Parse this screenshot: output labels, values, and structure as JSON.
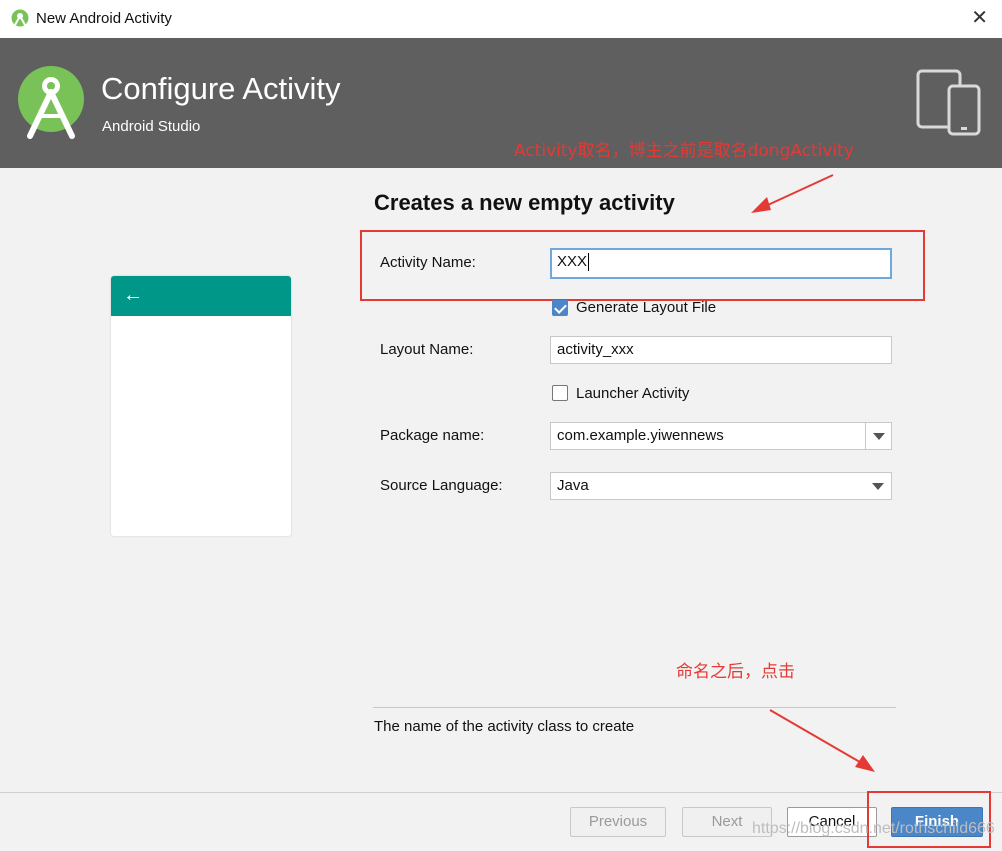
{
  "window": {
    "title": "New Android Activity",
    "close_glyph": "✕"
  },
  "header": {
    "title": "Configure Activity",
    "subtitle": "Android Studio"
  },
  "annotations": {
    "top_note": "Activity取名，博主之前是取名dongActivity",
    "bottom_note": "命名之后，点击"
  },
  "preview": {
    "back_glyph": "←"
  },
  "form": {
    "section_title": "Creates a new empty activity",
    "activity_name_label": "Activity Name:",
    "activity_name_value": "XXX",
    "generate_layout_label": "Generate Layout File",
    "generate_layout_checked": true,
    "layout_name_label": "Layout Name:",
    "layout_name_value": "activity_xxx",
    "launcher_label": "Launcher Activity",
    "launcher_checked": false,
    "package_label": "Package name:",
    "package_value": "com.example.yiwennews",
    "language_label": "Source Language:",
    "language_value": "Java"
  },
  "description": "The name of the activity class to create",
  "buttons": {
    "previous": "Previous",
    "next": "Next",
    "cancel": "Cancel",
    "finish": "Finish"
  },
  "watermark": "https://blog.csdn.net/rothschild666",
  "colors": {
    "header": "#5f5f5f",
    "accent": "#009688",
    "primary_button": "#4a86c8",
    "annotation": "#e53935"
  }
}
